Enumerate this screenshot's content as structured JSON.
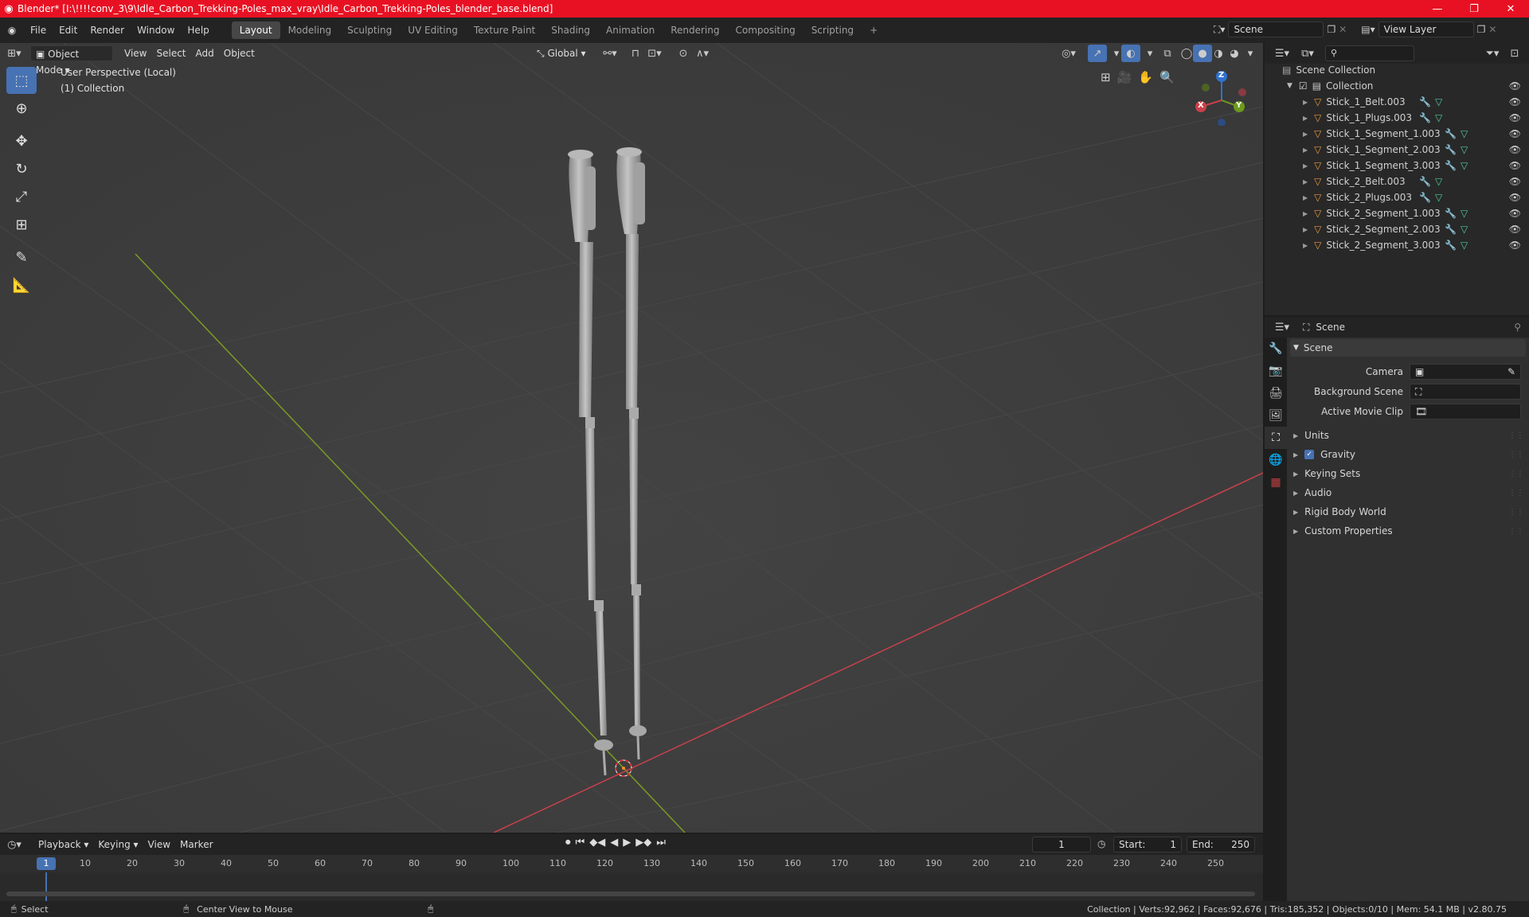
{
  "window": {
    "title": "Blender* [I:\\!!!!conv_3\\9\\Idle_Carbon_Trekking-Poles_max_vray\\Idle_Carbon_Trekking-Poles_blender_base.blend]",
    "minimize": "—",
    "maximize": "❐",
    "close": "✕"
  },
  "menu": [
    "File",
    "Edit",
    "Render",
    "Window",
    "Help"
  ],
  "workspaces": [
    "Layout",
    "Modeling",
    "Sculpting",
    "UV Editing",
    "Texture Paint",
    "Shading",
    "Animation",
    "Rendering",
    "Compositing",
    "Scripting"
  ],
  "active_workspace": "Layout",
  "scene_field": "Scene",
  "view_layer_field": "View Layer",
  "viewport": {
    "mode": "Object Mode",
    "menus": [
      "View",
      "Select",
      "Add",
      "Object"
    ],
    "transform_orientation": "Global",
    "overlay_line1": "User Perspective (Local)",
    "overlay_line2": "(1) Collection"
  },
  "gizmo": {
    "z": "Z",
    "y": "Y",
    "x": "X"
  },
  "outliner": {
    "root": "Scene Collection",
    "collection": "Collection",
    "objects": [
      "Stick_1_Belt.003",
      "Stick_1_Plugs.003",
      "Stick_1_Segment_1.003",
      "Stick_1_Segment_2.003",
      "Stick_1_Segment_3.003",
      "Stick_2_Belt.003",
      "Stick_2_Plugs.003",
      "Stick_2_Segment_1.003",
      "Stick_2_Segment_2.003",
      "Stick_2_Segment_3.003"
    ]
  },
  "properties": {
    "header": "Scene",
    "panel": "Scene",
    "camera_label": "Camera",
    "background_scene_label": "Background Scene",
    "active_movie_clip_label": "Active Movie Clip",
    "sections": [
      "Units",
      "Gravity",
      "Keying Sets",
      "Audio",
      "Rigid Body World",
      "Custom Properties"
    ],
    "gravity_checked": true
  },
  "timeline": {
    "menus": [
      "Playback",
      "Keying",
      "View",
      "Marker"
    ],
    "current_frame": "1",
    "start_label": "Start:",
    "start": "1",
    "end_label": "End:",
    "end": "250",
    "ticks": [
      "10",
      "20",
      "30",
      "40",
      "50",
      "60",
      "70",
      "80",
      "90",
      "100",
      "110",
      "120",
      "130",
      "140",
      "150",
      "160",
      "170",
      "180",
      "190",
      "200",
      "210",
      "220",
      "230",
      "240",
      "250"
    ],
    "frame_badge": "1"
  },
  "statusbar": {
    "select": "Select",
    "center_view": "Center View to Mouse",
    "stats": "Collection | Verts:92,962 | Faces:92,676 | Tris:185,352 | Objects:0/10 | Mem: 54.1 MB | v2.80.75"
  },
  "colors": {
    "accent": "#4772b3",
    "titlebar": "#e81123",
    "axis_x": "#c8414b",
    "axis_y": "#7a9a26",
    "object_icon": "#e89a3c"
  }
}
